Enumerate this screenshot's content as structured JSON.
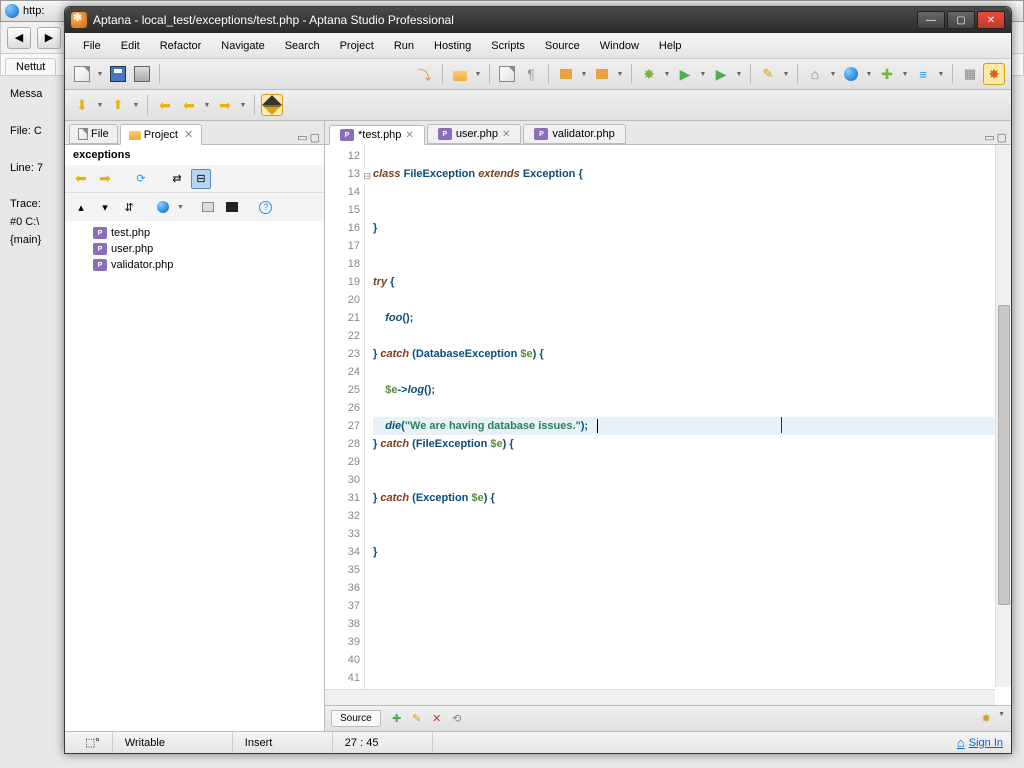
{
  "bg": {
    "url_prefix": "http:",
    "tab": "Nettut",
    "content": [
      "Messa",
      "",
      "File: C",
      "",
      "Line: 7",
      "",
      "Trace:",
      "#0 C:\\",
      "{main}"
    ]
  },
  "titlebar": "Aptana - local_test/exceptions/test.php - Aptana Studio Professional",
  "menu": [
    "File",
    "Edit",
    "Refactor",
    "Navigate",
    "Search",
    "Project",
    "Run",
    "Hosting",
    "Scripts",
    "Source",
    "Window",
    "Help"
  ],
  "left": {
    "tabs": [
      {
        "label": "File",
        "icon": "file"
      },
      {
        "label": "Project",
        "icon": "folder",
        "active": true
      }
    ],
    "header": "exceptions",
    "tree": [
      {
        "label": "test.php"
      },
      {
        "label": "user.php"
      },
      {
        "label": "validator.php"
      }
    ]
  },
  "editor": {
    "tabs": [
      {
        "label": "*test.php",
        "active": true,
        "close": true
      },
      {
        "label": "user.php",
        "close": true
      },
      {
        "label": "validator.php",
        "close": false
      }
    ],
    "gutter_start": 12,
    "gutter_end": 41,
    "highlight_line": 27,
    "bottom_tab": "Source"
  },
  "status": {
    "writable": "Writable",
    "insert": "Insert",
    "pos": "27 : 45",
    "signin": "Sign In"
  }
}
